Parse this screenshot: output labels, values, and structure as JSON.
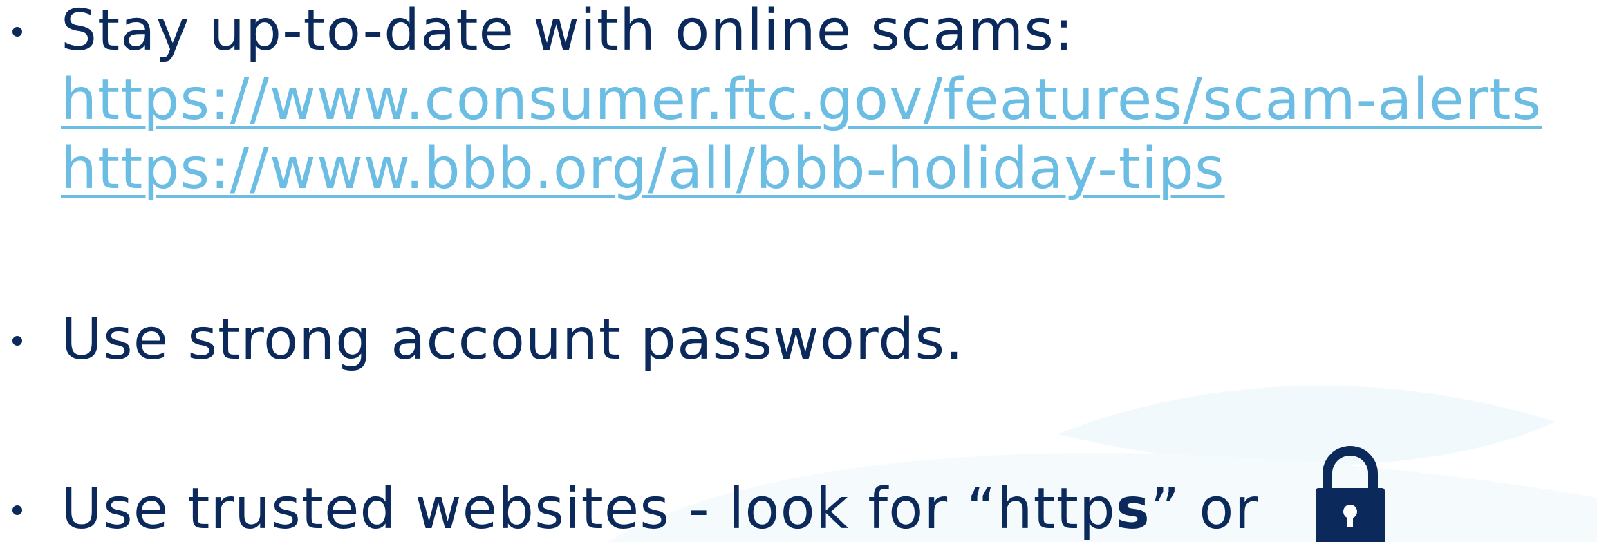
{
  "bullets": {
    "scams": {
      "text": "Stay up-to-date with online scams:",
      "links": [
        "https://www.consumer.ftc.gov/features/scam-alerts",
        "https://www.bbb.org/all/bbb-holiday-tips"
      ]
    },
    "passwords": {
      "text": "Use strong account passwords."
    },
    "websites": {
      "text_before": "Use trusted websites - look for “http",
      "text_bold": "s",
      "text_after": "” or"
    }
  },
  "icons": {
    "lock": "lock-icon"
  },
  "colors": {
    "text": "#0b2a5b",
    "link": "#6cbde3",
    "background_wave": "#eef7fc"
  }
}
